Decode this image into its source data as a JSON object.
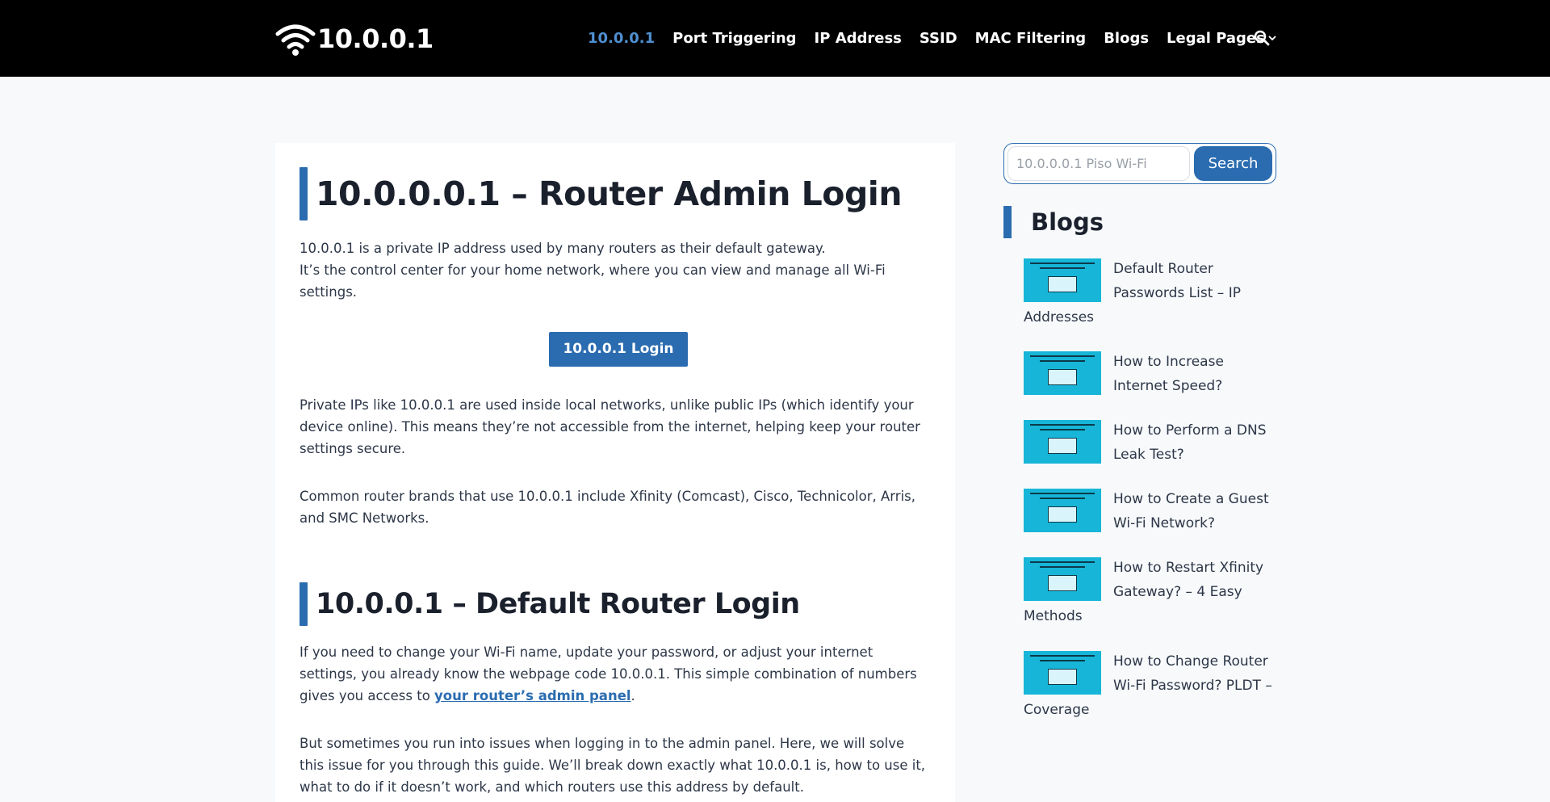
{
  "header": {
    "logo_text": "10.0.0.1",
    "nav": [
      {
        "label": "10.0.0.1",
        "active": true
      },
      {
        "label": "Port Triggering",
        "active": false
      },
      {
        "label": "IP Address",
        "active": false
      },
      {
        "label": "SSID",
        "active": false
      },
      {
        "label": "MAC Filtering",
        "active": false
      },
      {
        "label": "Blogs",
        "active": false
      },
      {
        "label": "Legal Pages",
        "active": false
      }
    ]
  },
  "main": {
    "h1": "10.0.0.0.1 – Router Admin Login",
    "p1_line1": "10.0.0.1 is a private IP address used by many routers as their default gateway.",
    "p1_line2": "It’s the control center for your home network, where you can view and manage all Wi-Fi settings.",
    "login_button": "10.0.0.1 Login",
    "p2": "Private IPs like 10.0.0.1 are used inside local networks, unlike public IPs (which identify your device online). This means they’re not accessible from the internet, helping keep your router settings secure.",
    "p3": "Common router brands that use 10.0.0.1 include Xfinity (Comcast), Cisco, Technicolor, Arris, and SMC Networks.",
    "h2": "10.0.0.1 – Default Router Login",
    "p4_before": "If you need to change your Wi-Fi name, update your password, or adjust your internet settings, you already know the webpage code 10.0.0.1. This simple combination of numbers gives you access to ",
    "p4_link": "your router’s admin panel",
    "p4_after": ".",
    "p5": "But sometimes you run into issues when logging in to the admin panel. Here, we will solve this issue for you through this guide. We’ll break down exactly what 10.0.0.1 is, how to use it, what to do if it doesn’t work, and which routers use this address by default."
  },
  "sidebar": {
    "search_placeholder": "10.0.0.0.1 Piso Wi-Fi",
    "search_button": "Search",
    "blogs_title": "Blogs",
    "posts": [
      {
        "title": "Default Router Passwords List – IP Addresses"
      },
      {
        "title": "How to Increase Internet Speed?"
      },
      {
        "title": "How to Perform a DNS Leak Test?"
      },
      {
        "title": "How to Create a Guest Wi-Fi Network?"
      },
      {
        "title": "How to Restart Xfinity Gateway? – 4 Easy Methods"
      },
      {
        "title": "How to Change Router Wi-Fi Password? PLDT – Coverage"
      }
    ]
  },
  "colors": {
    "header_bg": "#000000",
    "accent": "#2b6cb0",
    "nav_active": "#4f8fd0",
    "thumb_bg": "#17b6d8"
  }
}
